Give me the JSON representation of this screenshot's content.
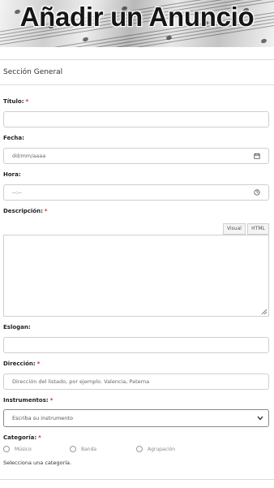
{
  "banner": {
    "title": "Añadir un Anuncio"
  },
  "section": {
    "title": "Sección General"
  },
  "fields": {
    "titulo": {
      "label": "Título:",
      "required": "*",
      "value": ""
    },
    "fecha": {
      "label": "Fecha:",
      "placeholder": "dd/mm/aaaa",
      "icon": "calendar-icon"
    },
    "hora": {
      "label": "Hora:",
      "placeholder": "--:--",
      "icon": "clock-icon"
    },
    "descripcion": {
      "label": "Descripción:",
      "required": "*",
      "tab_visual": "Visual",
      "tab_html": "HTML"
    },
    "eslogan": {
      "label": "Eslogan:",
      "value": ""
    },
    "direccion": {
      "label": "Dirección:",
      "required": "*",
      "placeholder": "Dirección del listado, por ejemplo. Valencia, Paterna"
    },
    "instrumentos": {
      "label": "Instrumentos:",
      "required": "*",
      "selected": "Escriba su instrumento",
      "icon": "chevron-down-icon"
    },
    "categoria": {
      "label": "Categoría:",
      "required": "*",
      "options": [
        "Músico",
        "Banda",
        "Agrupación"
      ],
      "hint": "Selecciona una categoría."
    }
  },
  "colors": {
    "required": "#d0302a",
    "border": "#cfcfcf"
  }
}
